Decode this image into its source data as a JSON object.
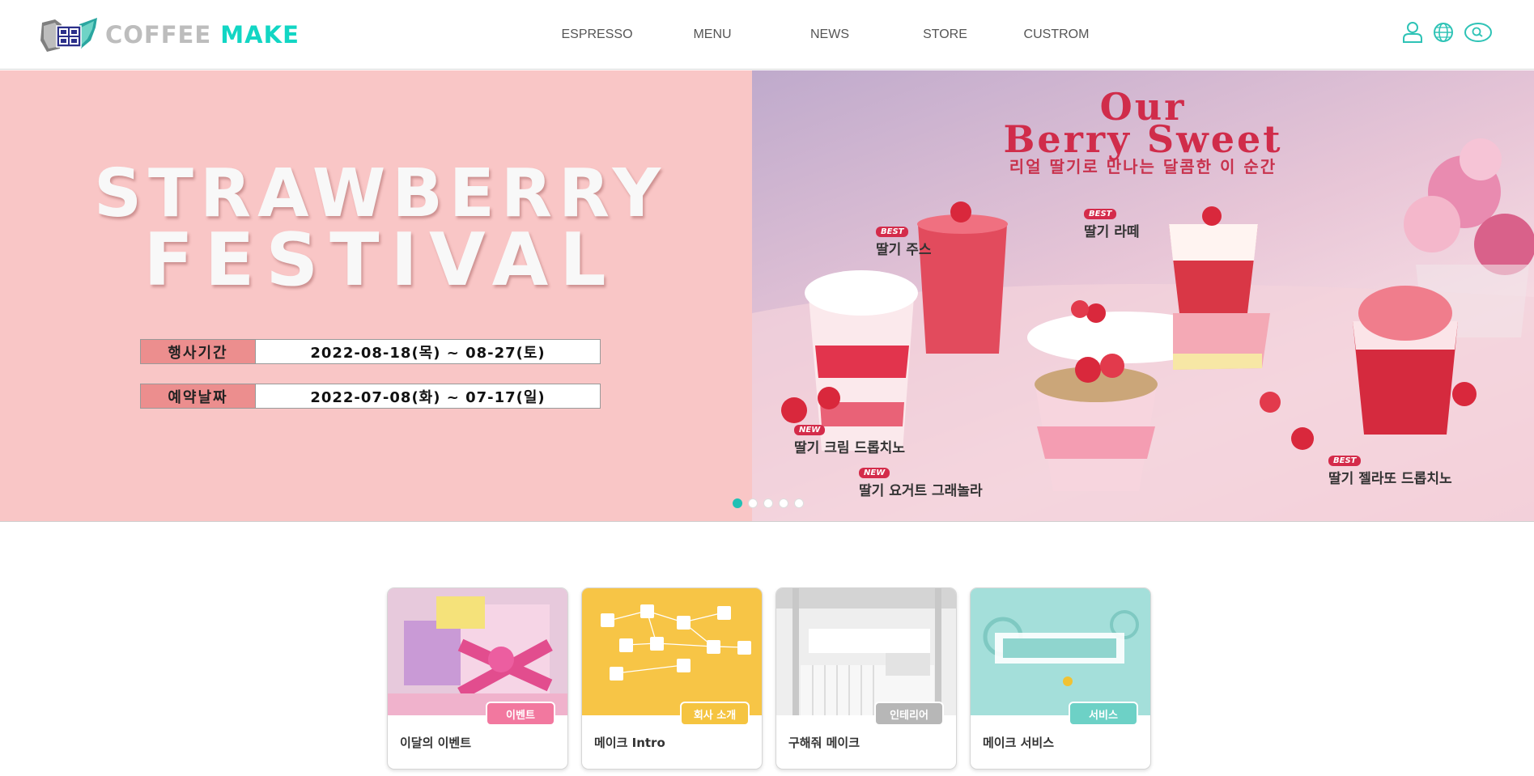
{
  "header": {
    "logo_word1": "COFFEE",
    "logo_word2": "MAKE",
    "nav": [
      "ESPRESSO",
      "MENU",
      "NEWS",
      "STORE",
      "CUSTROM"
    ],
    "utility_icons": [
      "user-icon",
      "globe-icon",
      "search-icon"
    ],
    "accent_color": "#12d6c4"
  },
  "hero": {
    "left": {
      "title_line1": "STRAWBERRY",
      "title_line2": "FESTIVAL",
      "events": [
        {
          "label": "행사기간",
          "value": "2022-08-18(목) ~ 08-27(토)"
        },
        {
          "label": "예약날짜",
          "value": "2022-07-08(화) ~ 07-17(일)"
        }
      ]
    },
    "right": {
      "title_line1": "Our",
      "title_line2": "Berry Sweet",
      "subtitle": "리얼 딸기로 만나는 달콤한 이 순간",
      "products": [
        {
          "tag": "BEST",
          "name": "딸기 주스"
        },
        {
          "tag": "BEST",
          "name": "딸기 라떼"
        },
        {
          "tag": "NEW",
          "name": "딸기 크림 드롭치노"
        },
        {
          "tag": "NEW",
          "name": "딸기 요거트 그래놀라"
        },
        {
          "tag": "BEST",
          "name": "딸기 젤라또 드롭치노"
        }
      ]
    },
    "slider": {
      "total": 5,
      "active": 1
    }
  },
  "cards": [
    {
      "badge": "이벤트",
      "title": "이달의 이벤트",
      "badge_color": "#f2789f"
    },
    {
      "badge": "회사 소개",
      "title": "메이크 Intro",
      "badge_color": "#f5c440"
    },
    {
      "badge": "인테리어",
      "title": "구해줘 메이크",
      "badge_color": "#b7b7b7"
    },
    {
      "badge": "서비스",
      "title": "메이크 서비스",
      "badge_color": "#6dd1c6"
    }
  ]
}
